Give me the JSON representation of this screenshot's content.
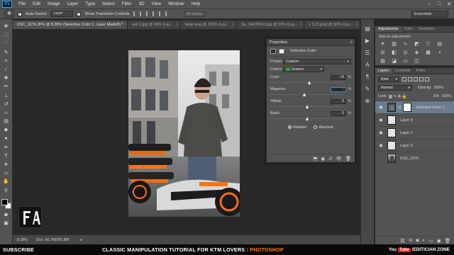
{
  "app": {
    "logo": "Ps"
  },
  "menu": [
    "File",
    "Edit",
    "Image",
    "Layer",
    "Type",
    "Select",
    "Filter",
    "3D",
    "View",
    "Window",
    "Help"
  ],
  "window_controls": [
    "–",
    "□",
    "✕"
  ],
  "options": {
    "auto_select_label": "Auto-Select:",
    "auto_select_value": "Layer",
    "transform_label": "Show Transform Controls",
    "mode_3d": "3D Mode:",
    "workspace": "Essentials"
  },
  "tabs": [
    {
      "label": "DSC_1676.JPG @ 8.28% (Selective Color 1, Layer Mask/8) *"
    },
    {
      "label": "rain 2.jpg @ 50% (Lay..."
    },
    {
      "label": "large.png @ 133% (Lay..."
    },
    {
      "label": "3a-_RAD5910.jpg @ 50% (Lay..."
    },
    {
      "label": "1 (1Z).jpeg @ 50% (Lay..."
    }
  ],
  "tab_close": "×",
  "properties": {
    "panel_title": "Properties",
    "title": "Selective Color",
    "preset_label": "Preset:",
    "preset_value": "Custom",
    "colors_label": "Colors:",
    "colors_value": "Greens",
    "color_chip": "#2e9c3a",
    "sliders": [
      {
        "label": "Cyan:",
        "value": "+6",
        "pct": "%",
        "position": 0.53
      },
      {
        "label": "Magenta:",
        "value": "-",
        "pct": "%",
        "position": 0.47
      },
      {
        "label": "Yellow:",
        "value": "0",
        "pct": "%",
        "position": 0.5
      },
      {
        "label": "Black:",
        "value": "0",
        "pct": "%",
        "position": 0.5
      }
    ],
    "radio_relative": "Relative",
    "radio_absolute": "Absolute"
  },
  "adjustments": {
    "tabs": [
      "Adjustments",
      "Color",
      "Swatches"
    ],
    "add_label": "Add an adjustment"
  },
  "layers": {
    "tabs": [
      "Layers",
      "Channels",
      "Paths"
    ],
    "filter_kind": "Kind",
    "blend_mode": "Normal",
    "opacity_label": "Opacity:",
    "opacity_value": "100%",
    "lock_label": "Lock:",
    "fill_label": "Fill:",
    "fill_value": "100%",
    "items": [
      {
        "name": "Selective Color 1",
        "visible": true,
        "selected": true
      },
      {
        "name": "Layer 4",
        "visible": true,
        "selected": false
      },
      {
        "name": "Layer 1",
        "visible": true,
        "selected": false
      },
      {
        "name": "Layer 3",
        "visible": true,
        "selected": false
      },
      {
        "name": "DSC_1676",
        "visible": false,
        "selected": false
      }
    ]
  },
  "status": {
    "zoom": "8.28%",
    "doc": "Doc: 66.7M/391.8M"
  },
  "subtitle": {
    "left": "SUBSCRIBE",
    "center_main": "CLASSIC MANIPULATION TUTORIAL FOR KTM LOVERS :",
    "center_accent": "PHOTOSHOP",
    "yt_you": "You",
    "yt_tube": "Tube",
    "channel": "/EDITICIAN ZONE"
  }
}
